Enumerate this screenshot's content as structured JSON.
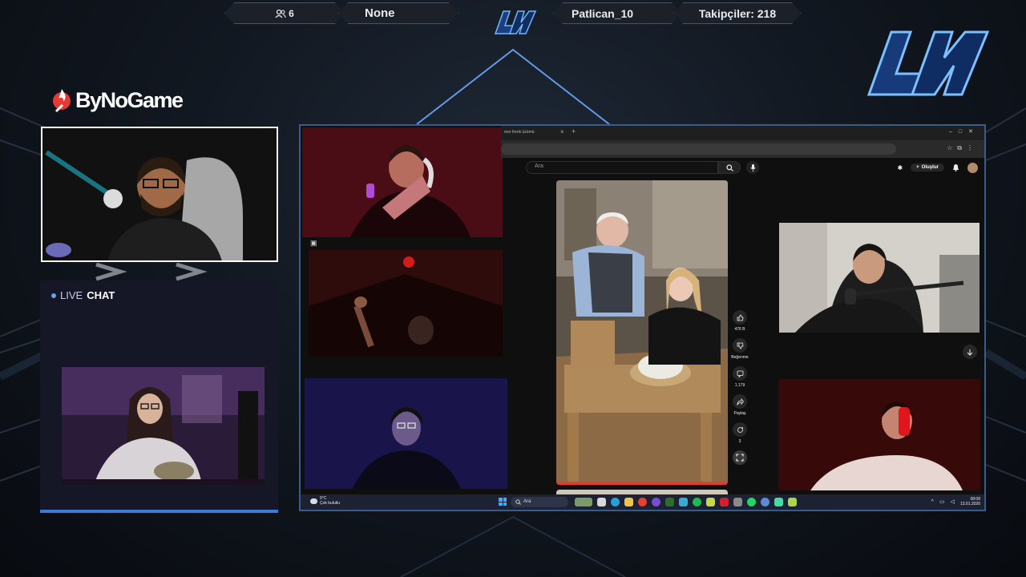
{
  "topbar": {
    "viewers_icon": "users-icon",
    "viewers": "6",
    "game": "None",
    "streamer": "Patlican_10",
    "followers": "Takipçiler: 218"
  },
  "sponsor": {
    "logo_icon": "flame-icon",
    "name": "ByNoGame"
  },
  "chat": {
    "live": "LIVE",
    "title": "CHAT"
  },
  "browser": {
    "tab_title": "mor frenk üzümü",
    "tab_close": "×",
    "new_tab": "+"
  },
  "youtube": {
    "search_placeholder": "Ara",
    "create_label": "Oluştur",
    "likes": "476 B",
    "dislike_label": "Beğenme",
    "comments": "1.179",
    "share_label": "Paylaş",
    "remix_count": "3"
  },
  "taskbar": {
    "weather_temp": "9°C",
    "weather_desc": "Çok bulutlu",
    "search_label": "Ara",
    "time": "08:08",
    "date": "13.01.2026"
  },
  "colors": {
    "accent": "#3c7ad6",
    "chat_panel": "#151626",
    "topbar_bg": "#1b2029"
  }
}
